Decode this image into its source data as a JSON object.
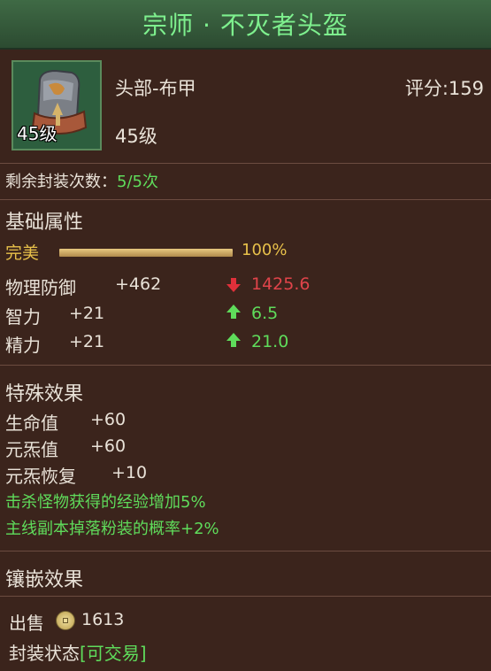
{
  "title": "宗师 · 不灭者头盔",
  "item": {
    "icon": "helmet-icon",
    "level_badge": "45级",
    "type": "头部-布甲",
    "score": "评分:159",
    "level": "45级"
  },
  "seal_count": {
    "label": "剩余封装次数：",
    "value": "5/5次"
  },
  "base": {
    "heading": "基础属性",
    "quality_label": "完美",
    "quality_percent": "100%",
    "quality_fraction": 1.0,
    "stats": [
      {
        "name": "物理防御",
        "value": "+462",
        "compare": "1425.6",
        "direction": "down"
      },
      {
        "name": "智力",
        "value": "+21",
        "compare": "6.5",
        "direction": "up"
      },
      {
        "name": "精力",
        "value": "+21",
        "compare": "21.0",
        "direction": "up"
      }
    ]
  },
  "special": {
    "heading": "特殊效果",
    "stats": [
      {
        "name": "生命值",
        "value": "+60"
      },
      {
        "name": "元炁值",
        "value": "+60"
      },
      {
        "name": "元炁恢复",
        "value": "+10"
      }
    ],
    "effects": [
      "击杀怪物获得的经验增加5%",
      "主线副本掉落粉装的概率+2%"
    ]
  },
  "inlay": {
    "heading": "镶嵌效果"
  },
  "sell": {
    "label": "出售",
    "price": "1613",
    "icon": "coin-icon"
  },
  "seal_status": {
    "label": "封装状态",
    "value": "[可交易]"
  },
  "colors": {
    "title": "#7ef08e",
    "positive": "#5fdc5b",
    "negative": "#e0444a",
    "quality": "#e8c14a",
    "background": "#3b241c"
  }
}
